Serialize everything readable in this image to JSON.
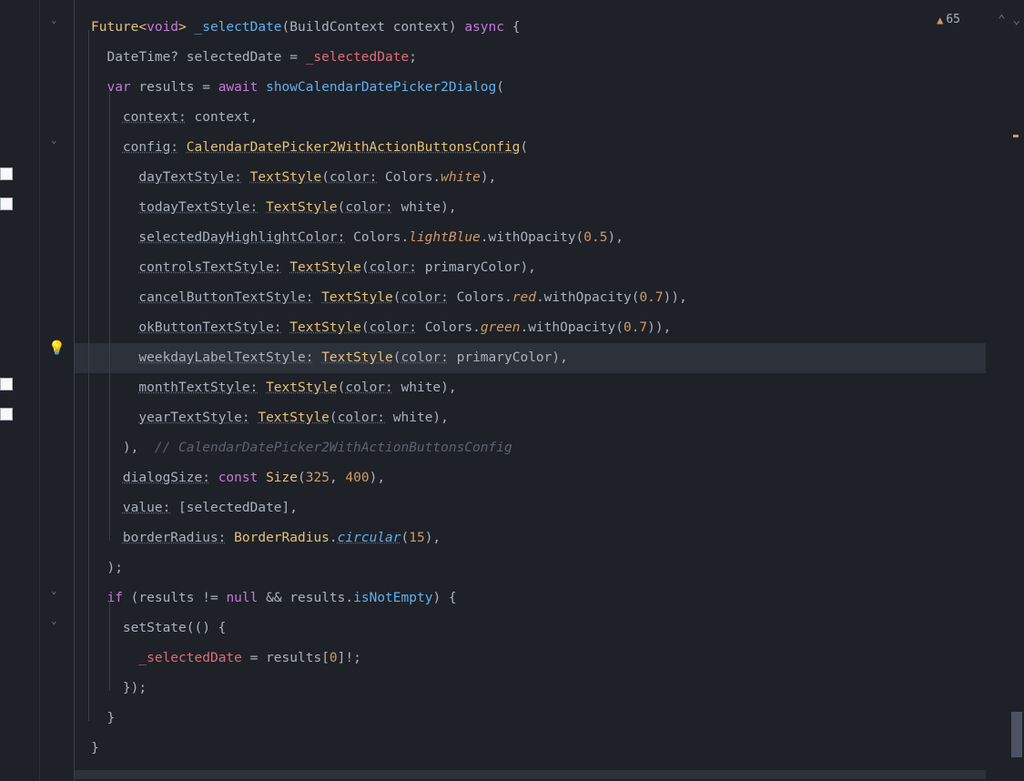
{
  "warnings": {
    "count": "65"
  },
  "code": {
    "l1": {
      "a": "Future<",
      "b": "void",
      "c": "> ",
      "d": "_selectDate",
      "e": "(BuildContext context) ",
      "f": "async",
      "g": " {"
    },
    "l2": {
      "a": "  DateTime? selectedDate = ",
      "b": "_selectedDate",
      "c": ";"
    },
    "l3": {
      "a": "  ",
      "b": "var",
      "c": " results = ",
      "d": "await",
      "e": " ",
      "f": "showCalendarDatePicker2Dialog",
      "g": "("
    },
    "l4": {
      "a": "    ",
      "b": "context:",
      "c": " context,"
    },
    "l5": {
      "a": "    ",
      "b": "config:",
      "c": " ",
      "d": "CalendarDatePicker2WithActionButtonsConfig",
      "e": "("
    },
    "l6": {
      "a": "      ",
      "b": "dayTextStyle:",
      "c": " ",
      "d": "TextStyle",
      "e": "(",
      "f": "color:",
      "g": " Colors.",
      "h": "white",
      "i": "),"
    },
    "l7": {
      "a": "      ",
      "b": "todayTextStyle:",
      "c": " ",
      "d": "TextStyle",
      "e": "(",
      "f": "color:",
      "g": " white),"
    },
    "l8": {
      "a": "      ",
      "b": "selectedDayHighlightColor:",
      "c": " Colors.",
      "d": "lightBlue",
      "e": ".withOpacity(",
      "f": "0.5",
      "g": "),"
    },
    "l9": {
      "a": "      ",
      "b": "controlsTextStyle:",
      "c": " ",
      "d": "TextStyle",
      "e": "(",
      "f": "color:",
      "g": " primaryColor),"
    },
    "l10": {
      "a": "      ",
      "b": "cancelButtonTextStyle:",
      "c": " ",
      "d": "TextStyle",
      "e": "(",
      "f": "color:",
      "g": " Colors.",
      "h": "red",
      "i": ".withOpacity(",
      "j": "0.7",
      "k": ")),"
    },
    "l11": {
      "a": "      ",
      "b": "okButtonTextStyle:",
      "c": " ",
      "d": "TextStyle",
      "e": "(",
      "f": "color:",
      "g": " Colors.",
      "h": "green",
      "i": ".withOpacity(",
      "j": "0.7",
      "k": ")),"
    },
    "l12": {
      "a": "      ",
      "b": "weekdayLabelTextStyle:",
      "c": " ",
      "d": "TextStyle",
      "e": "(",
      "f": "color:",
      "g": " primaryColor),"
    },
    "l13": {
      "a": "      ",
      "b": "monthTextStyle:",
      "c": " ",
      "d": "TextStyle",
      "e": "(",
      "f": "color:",
      "g": " white),"
    },
    "l14": {
      "a": "      ",
      "b": "yearTextStyle:",
      "c": " ",
      "d": "TextStyle",
      "e": "(",
      "f": "color:",
      "g": " white),"
    },
    "l15": {
      "a": "    ),  ",
      "b": "// CalendarDatePicker2WithActionButtonsConfig"
    },
    "l16": {
      "a": "    ",
      "b": "dialogSize:",
      "c": " ",
      "d": "const",
      "e": " ",
      "f": "Size",
      "g": "(",
      "h": "325",
      "i": ", ",
      "j": "400",
      "k": "),"
    },
    "l17": {
      "a": "    ",
      "b": "value:",
      "c": " [selectedDate],"
    },
    "l18": {
      "a": "    ",
      "b": "borderRadius:",
      "c": " ",
      "d": "BorderRadius",
      "e": ".",
      "f": "circular",
      "g": "(",
      "h": "15",
      "i": "),"
    },
    "l19": {
      "a": "  );"
    },
    "l20": {
      "a": "  ",
      "b": "if",
      "c": " (results != ",
      "d": "null",
      "e": " && results.",
      "f": "isNotEmpty",
      "g": ") {"
    },
    "l21": {
      "a": "    setState(() {"
    },
    "l22": {
      "a": "      ",
      "b": "_selectedDate",
      "c": " = results[",
      "d": "0",
      "e": "]!;"
    },
    "l23": {
      "a": "    });"
    },
    "l24": {
      "a": "  }"
    },
    "l25": {
      "a": "}"
    }
  }
}
